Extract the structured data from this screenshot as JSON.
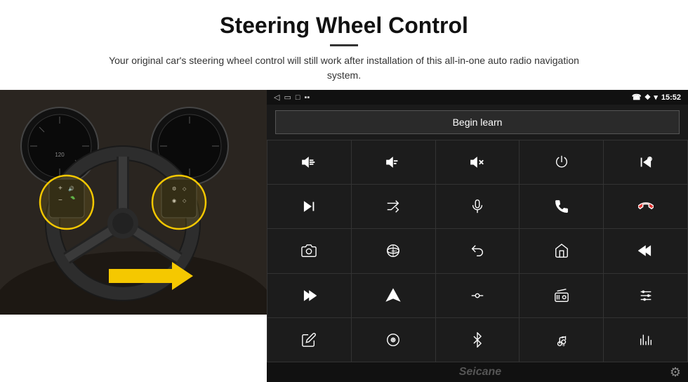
{
  "header": {
    "title": "Steering Wheel Control",
    "subtitle": "Your original car's steering wheel control will still work after installation of this all-in-one auto radio navigation system."
  },
  "status_bar": {
    "back_icon": "◁",
    "home_rect_icon": "▭",
    "square_icon": "□",
    "signal_icon": "▪▪",
    "phone_icon": "☎",
    "location_icon": "⬥",
    "wifi_icon": "▾",
    "time": "15:52"
  },
  "control": {
    "begin_learn_label": "Begin learn"
  },
  "icons": [
    {
      "name": "vol-up",
      "symbol": "vol+"
    },
    {
      "name": "vol-down",
      "symbol": "vol-"
    },
    {
      "name": "vol-mute",
      "symbol": "vol×"
    },
    {
      "name": "power",
      "symbol": "power"
    },
    {
      "name": "prev-track-phone",
      "symbol": "prev+phone"
    },
    {
      "name": "next-track",
      "symbol": "next"
    },
    {
      "name": "shuffle-next",
      "symbol": "shuf+next"
    },
    {
      "name": "microphone",
      "symbol": "mic"
    },
    {
      "name": "phone-call",
      "symbol": "call"
    },
    {
      "name": "phone-end",
      "symbol": "end"
    },
    {
      "name": "camera",
      "symbol": "cam"
    },
    {
      "name": "360-view",
      "symbol": "360"
    },
    {
      "name": "back",
      "symbol": "back"
    },
    {
      "name": "home",
      "symbol": "home"
    },
    {
      "name": "prev-track-2",
      "symbol": "prev"
    },
    {
      "name": "fast-forward",
      "symbol": "ff"
    },
    {
      "name": "navigate",
      "symbol": "nav"
    },
    {
      "name": "equalizer",
      "symbol": "eq"
    },
    {
      "name": "radio",
      "symbol": "radio"
    },
    {
      "name": "sliders",
      "symbol": "sliders"
    },
    {
      "name": "pen",
      "symbol": "pen"
    },
    {
      "name": "cd",
      "symbol": "cd"
    },
    {
      "name": "bluetooth",
      "symbol": "bt"
    },
    {
      "name": "music-settings",
      "symbol": "music"
    },
    {
      "name": "bars",
      "symbol": "bars"
    }
  ],
  "watermark": "Seicane"
}
